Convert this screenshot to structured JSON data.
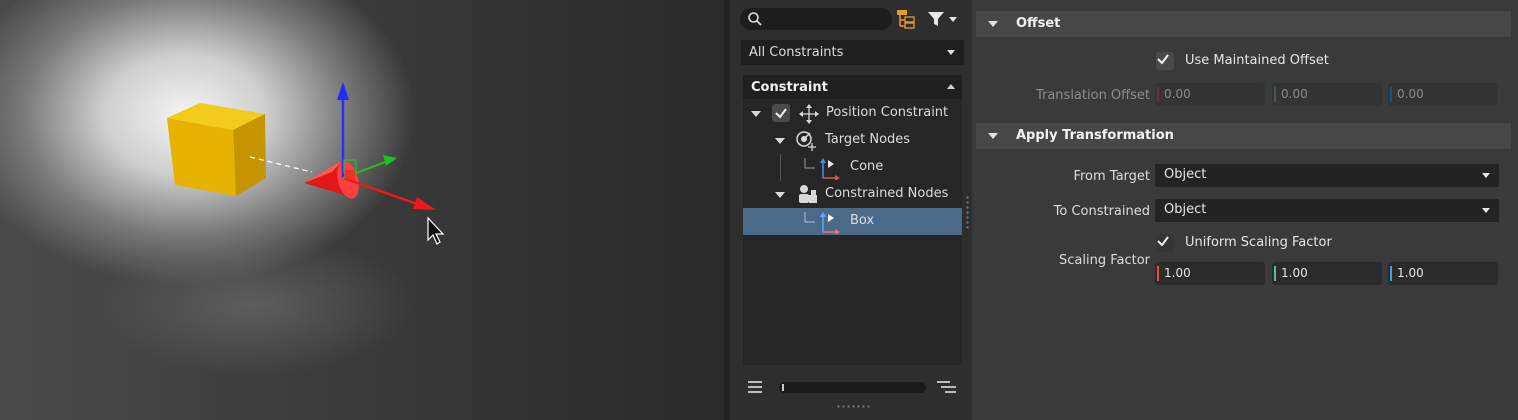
{
  "left_panel": {
    "search": {
      "placeholder": "",
      "value": ""
    },
    "filter_dropdown": {
      "value": "All Constraints"
    },
    "tree": {
      "header": "Constraint",
      "items": [
        {
          "label": "Position Constraint",
          "icon": "move-arrows-icon",
          "checked": true
        },
        {
          "label": "Target Nodes",
          "icon": "target-nodes-icon"
        },
        {
          "label": "Cone",
          "icon": "node-axis-icon"
        },
        {
          "label": "Constrained Nodes",
          "icon": "constrained-nodes-icon"
        },
        {
          "label": "Box",
          "icon": "node-axis-icon",
          "selected": true
        }
      ]
    }
  },
  "offset": {
    "title": "Offset",
    "use_maintained_offset": {
      "label": "Use Maintained Offset",
      "checked": true
    },
    "translation_offset": {
      "label": "Translation Offset",
      "x": "0.00",
      "y": "0.00",
      "z": "0.00"
    }
  },
  "apply_transformation": {
    "title": "Apply Transformation",
    "from_target": {
      "label": "From Target",
      "value": "Object"
    },
    "to_constrained": {
      "label": "To Constrained",
      "value": "Object"
    },
    "uniform_scaling": {
      "label": "Uniform Scaling Factor",
      "checked": true
    },
    "scaling_factor": {
      "label": "Scaling Factor",
      "x": "1.00",
      "y": "1.00",
      "z": "1.00"
    }
  },
  "colors": {
    "x_axis": "#e0302e",
    "y_axis": "#2ec02e",
    "z_axis": "#2b6cf0",
    "selection": "#4b6a8a",
    "cube": "#e8b800",
    "cone": "#ee1c1c"
  }
}
